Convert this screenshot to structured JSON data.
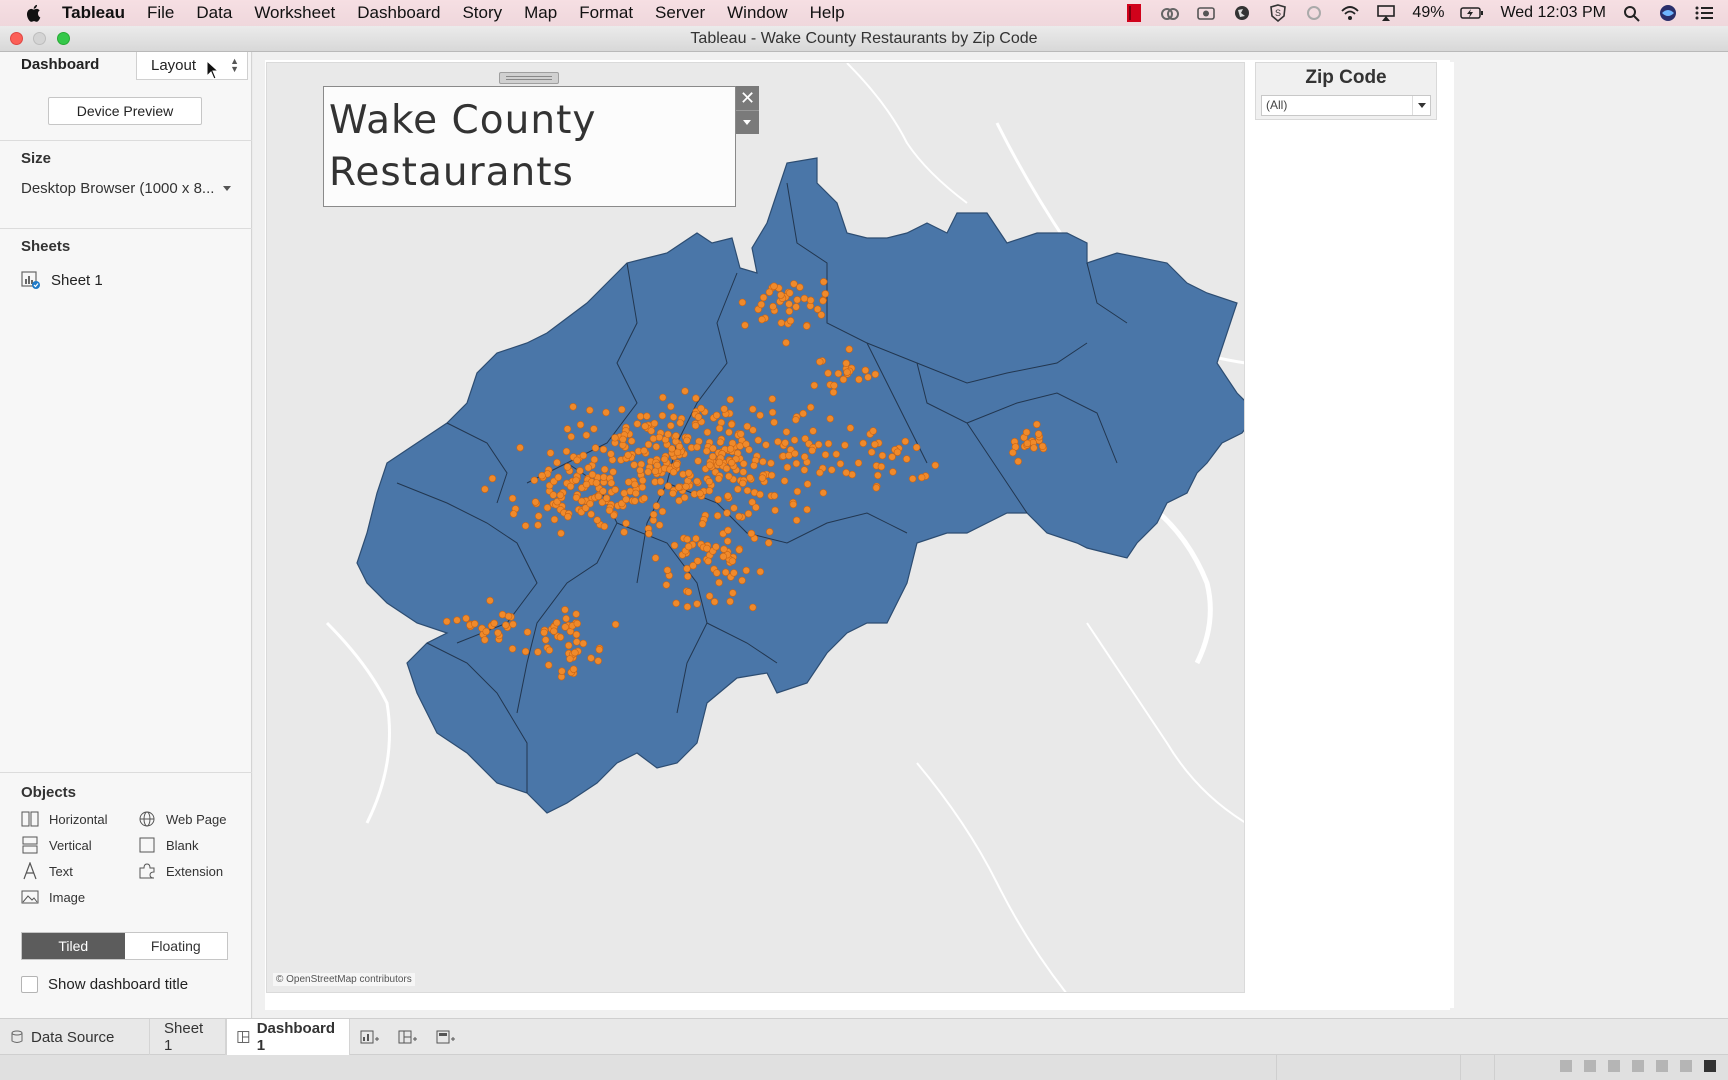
{
  "menubar": {
    "items": [
      "Tableau",
      "File",
      "Data",
      "Worksheet",
      "Dashboard",
      "Story",
      "Map",
      "Format",
      "Server",
      "Window",
      "Help"
    ],
    "battery": "49%",
    "clock": "Wed 12:03 PM"
  },
  "window": {
    "title": "Tableau - Wake County Restaurants by Zip Code"
  },
  "left_panel": {
    "tabs": {
      "dashboard": "Dashboard",
      "layout": "Layout"
    },
    "device_preview": "Device Preview",
    "size": {
      "title": "Size",
      "value": "Desktop Browser (1000 x 8..."
    },
    "sheets": {
      "title": "Sheets",
      "items": [
        "Sheet 1"
      ]
    },
    "objects": {
      "title": "Objects",
      "items": [
        "Horizontal",
        "Web Page",
        "Vertical",
        "Blank",
        "Text",
        "Extension",
        "Image"
      ]
    },
    "layout_mode": {
      "tiled": "Tiled",
      "floating": "Floating",
      "active": "Tiled"
    },
    "show_title": {
      "label": "Show dashboard title",
      "checked": false
    }
  },
  "dashboard": {
    "title_lines": [
      "Wake County",
      "Restaurants"
    ],
    "map_attribution": "© OpenStreetMap contributors",
    "region_color": "#4a76a8",
    "marker_color": "#f08a2b",
    "filter": {
      "title": "Zip Code",
      "value": "(All)"
    }
  },
  "bottom_tabs": {
    "data_source": "Data Source",
    "sheet": "Sheet 1",
    "dashboard": "Dashboard 1"
  }
}
